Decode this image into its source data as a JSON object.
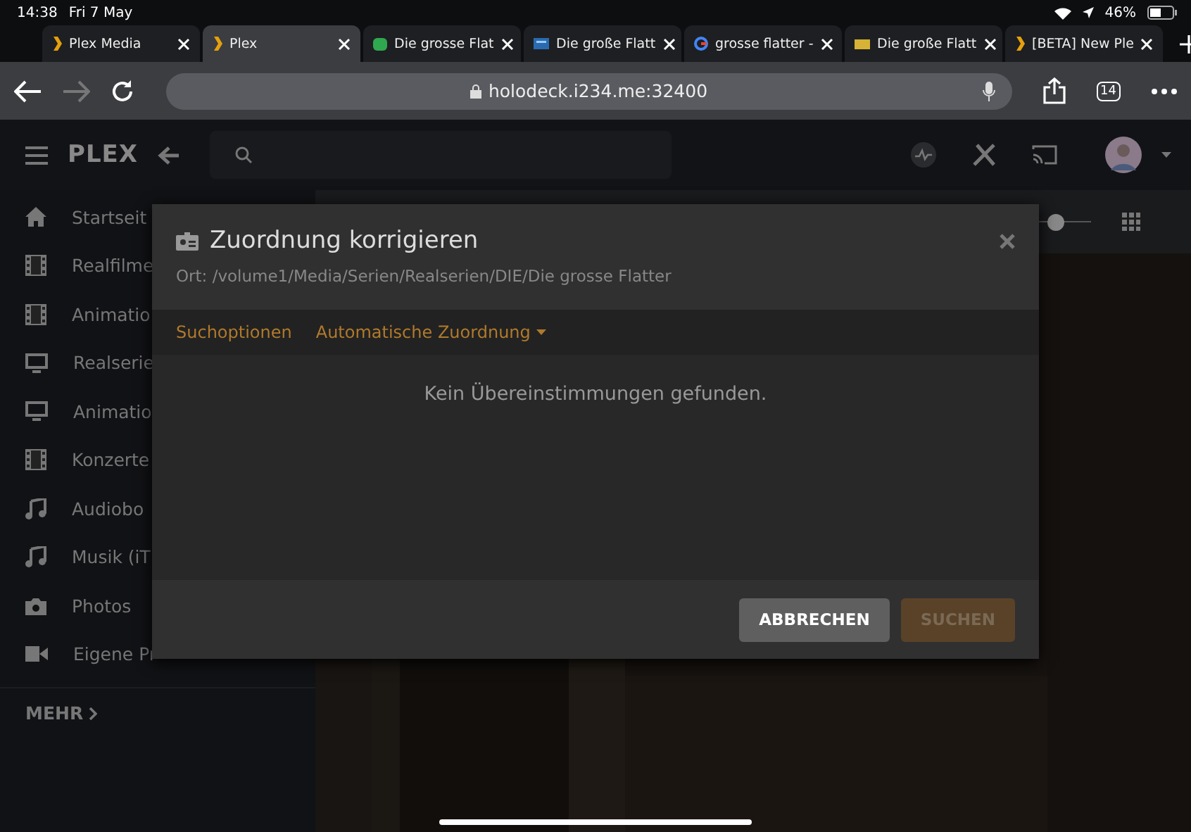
{
  "status_bar": {
    "time": "14:38",
    "date": "Fri 7 May",
    "battery": "46%"
  },
  "browser_tabs": [
    {
      "title": "Plex Media",
      "selected": false,
      "kind": "plex"
    },
    {
      "title": "Plex",
      "selected": true,
      "kind": "plex"
    },
    {
      "title": "Die grosse Flat",
      "selected": false,
      "kind": "green"
    },
    {
      "title": "Die große Flatt",
      "selected": false,
      "kind": "blue"
    },
    {
      "title": "grosse flatter -",
      "selected": false,
      "kind": "google"
    },
    {
      "title": "Die große Flatt",
      "selected": false,
      "kind": "yellow"
    },
    {
      "title": "[BETA] New Ple",
      "selected": false,
      "kind": "plex"
    }
  ],
  "address_bar": {
    "url": "holodeck.i234.me:32400",
    "tab_count": "14"
  },
  "app_header": {
    "logo": "PLEX"
  },
  "view_controls": {
    "size_slider": {
      "level": 0.45
    }
  },
  "sidebar": {
    "items": [
      {
        "label": "Startseit",
        "kind": "home"
      },
      {
        "label": "Realfilme",
        "kind": "film"
      },
      {
        "label": "Animatio",
        "kind": "film"
      },
      {
        "label": "Realserie",
        "kind": "tv"
      },
      {
        "label": "Animatio",
        "kind": "tv"
      },
      {
        "label": "Konzerte",
        "kind": "film"
      },
      {
        "label": "Audiobo",
        "kind": "music"
      },
      {
        "label": "Musik (iT",
        "kind": "music"
      },
      {
        "label": "Photos"
      },
      {
        "label": "Eigene Pr",
        "kind": "video"
      }
    ],
    "more": "MEHR"
  },
  "dialog": {
    "title": "Zuordnung korrigieren",
    "location": "Ort: /volume1/Media/Serien/Realserien/DIE/Die grosse Flatter",
    "options": [
      "Suchoptionen",
      "Automatische Zuordnung"
    ],
    "message": "Kein Übereinstimmungen gefunden.",
    "buttons": [
      {
        "label": "ABBRECHEN",
        "disabled": false
      },
      {
        "label": "SUCHEN",
        "disabled": true
      }
    ]
  }
}
